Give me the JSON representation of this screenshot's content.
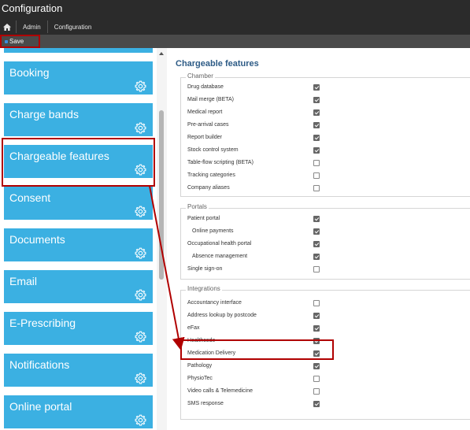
{
  "app": {
    "title": "Configuration"
  },
  "breadcrumb": {
    "home_icon": "home-icon",
    "items": [
      "Admin",
      "Configuration"
    ]
  },
  "toolbar": {
    "save_label": "Save"
  },
  "sidebar": {
    "items": [
      {
        "label": ""
      },
      {
        "label": "Booking"
      },
      {
        "label": "Charge bands"
      },
      {
        "label": "Chargeable features"
      },
      {
        "label": "Consent"
      },
      {
        "label": "Documents"
      },
      {
        "label": "Email"
      },
      {
        "label": "E-Prescribing"
      },
      {
        "label": "Notifications"
      },
      {
        "label": "Online portal"
      }
    ],
    "tile_color": "#3bb0e2",
    "icon": "gear-icon"
  },
  "main": {
    "title": "Chargeable features",
    "groups": [
      {
        "legend": "Chamber",
        "rows": [
          {
            "label": "Drug database",
            "checked": true
          },
          {
            "label": "Mail merge (BETA)",
            "checked": true
          },
          {
            "label": "Medical report",
            "checked": true
          },
          {
            "label": "Pre-arrival cases",
            "checked": true
          },
          {
            "label": "Report builder",
            "checked": true
          },
          {
            "label": "Stock control system",
            "checked": true
          },
          {
            "label": "Table-flow scripting (BETA)",
            "checked": false
          },
          {
            "label": "Tracking categories",
            "checked": false
          },
          {
            "label": "Company aliases",
            "checked": false
          }
        ]
      },
      {
        "legend": "Portals",
        "rows": [
          {
            "label": "Patient portal",
            "checked": true
          },
          {
            "label": "Online payments",
            "checked": true
          },
          {
            "label": "Occupational health portal",
            "checked": true
          },
          {
            "label": "Absence management",
            "checked": true
          },
          {
            "label": "Single sign-on",
            "checked": false
          }
        ]
      },
      {
        "legend": "Integrations",
        "rows": [
          {
            "label": "Accountancy interface",
            "checked": false
          },
          {
            "label": "Address lookup by postcode",
            "checked": true
          },
          {
            "label": "eFax",
            "checked": true
          },
          {
            "label": "Healthcode",
            "checked": true
          },
          {
            "label": "Medication Delivery",
            "checked": true
          },
          {
            "label": "Pathology",
            "checked": true
          },
          {
            "label": "PhysioTec",
            "checked": false
          },
          {
            "label": "Video calls & Telemedicine",
            "checked": false
          },
          {
            "label": "SMS response",
            "checked": true
          }
        ]
      }
    ]
  },
  "highlight_color": "#b00000"
}
